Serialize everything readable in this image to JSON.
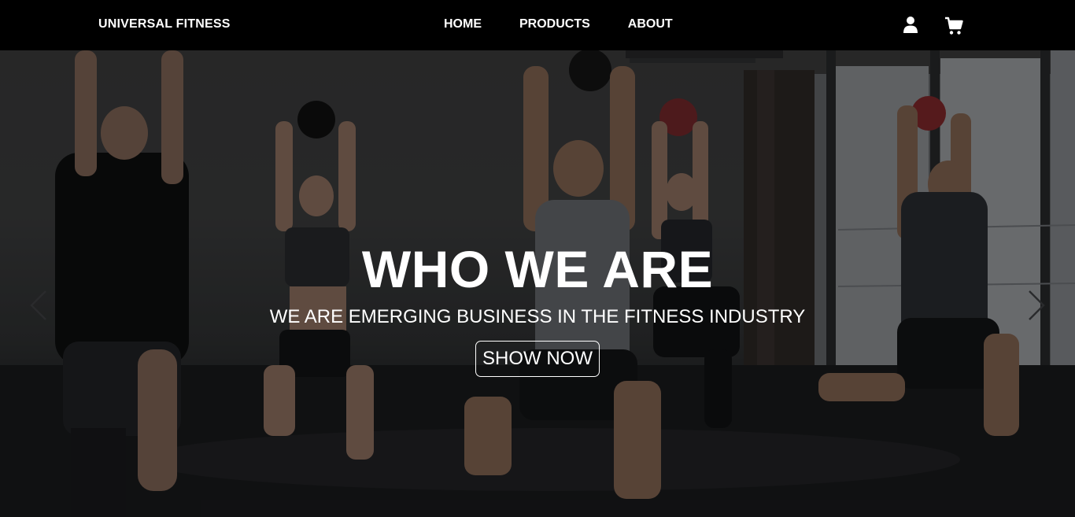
{
  "navbar": {
    "brand": "UNIVERSAL FITNESS",
    "links": [
      {
        "label": "HOME"
      },
      {
        "label": "PRODUCTS"
      },
      {
        "label": "ABOUT"
      }
    ],
    "icons": [
      "user-icon",
      "cart-icon"
    ]
  },
  "hero": {
    "title": "WHO WE ARE",
    "subtitle": "WE ARE EMERGING BUSINESS IN THE FITNESS INDUSTRY",
    "button_label": "SHOW NOW",
    "arrows": [
      "chevron-left-icon",
      "chevron-right-icon"
    ]
  },
  "colors": {
    "navbar_bg": "#000000",
    "text": "#ffffff",
    "overlay": "rgba(0,0,0,0.38)"
  }
}
